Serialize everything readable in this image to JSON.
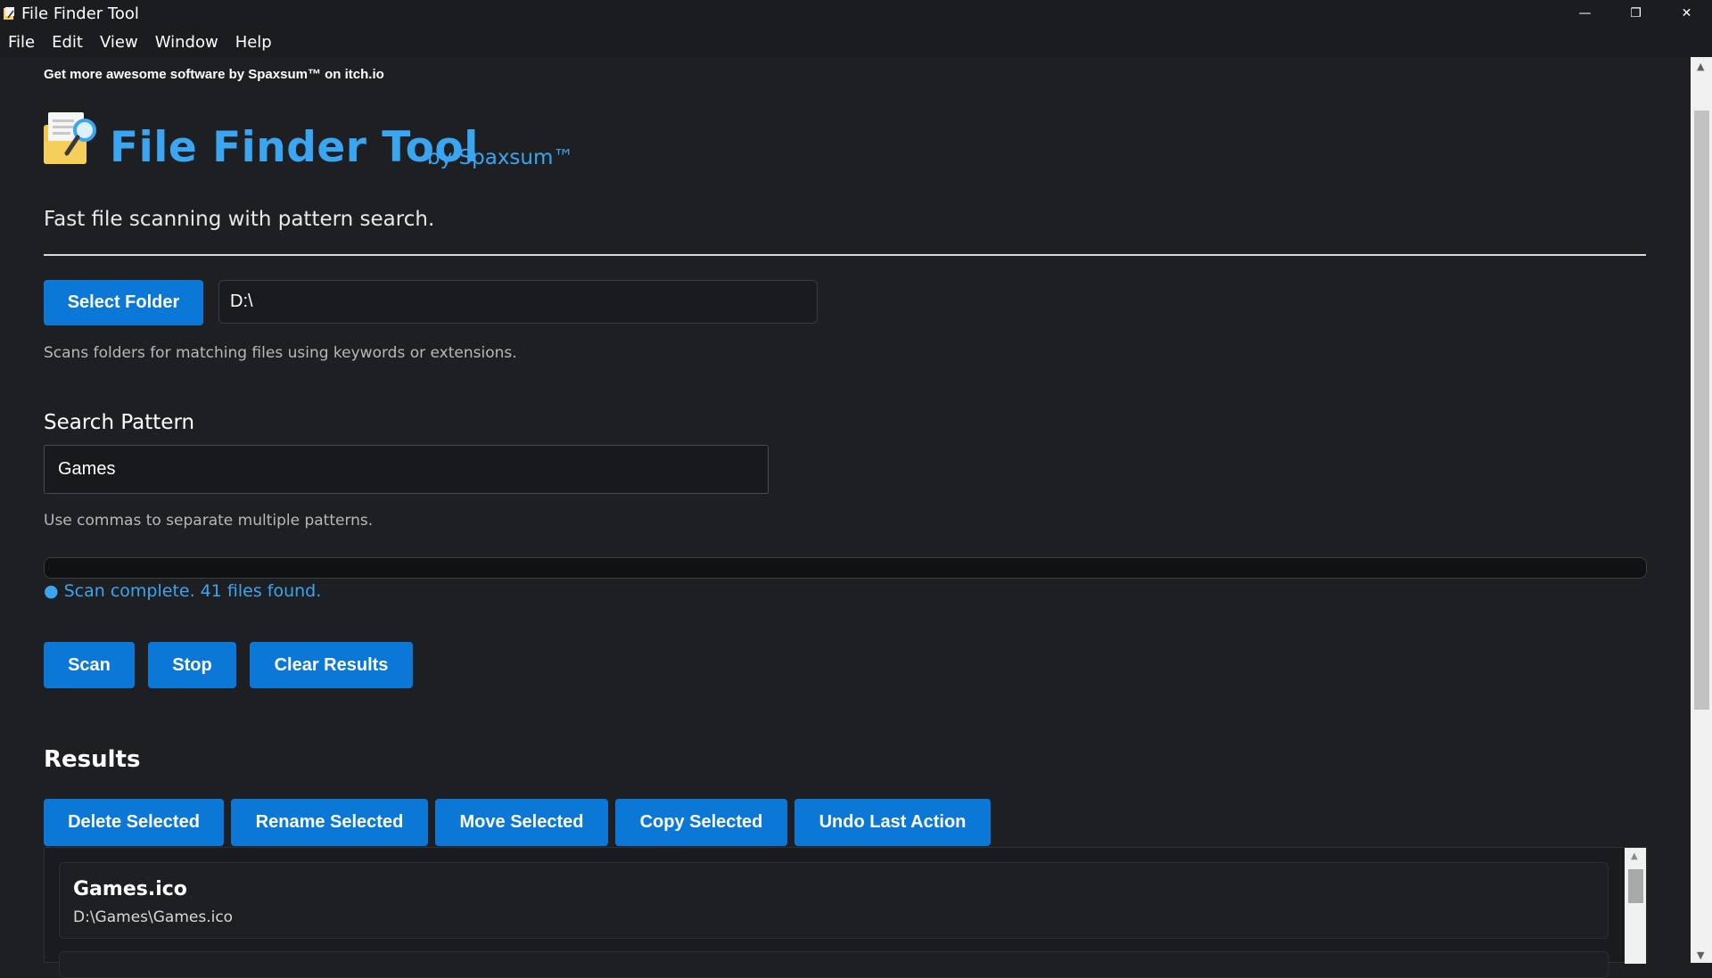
{
  "window": {
    "title": "File Finder Tool",
    "minimize_glyph": "—",
    "restore_glyph": "❐",
    "close_glyph": "✕"
  },
  "menu": [
    "File",
    "Edit",
    "View",
    "Window",
    "Help"
  ],
  "promo": "Get more awesome software by Spaxsum™ on itch.io",
  "header": {
    "title": "File Finder Tool",
    "by": "by Spaxsum™",
    "tagline": "Fast file scanning with pattern search."
  },
  "folder": {
    "button": "Select Folder",
    "path": "D:\\",
    "hint": "Scans folders for matching files using keywords or extensions."
  },
  "search": {
    "label": "Search Pattern",
    "value": "Games",
    "hint": "Use commas to separate multiple patterns."
  },
  "progress": {
    "fraction": 0
  },
  "status": "● Scan complete. 41 files found.",
  "actions": {
    "scan": "Scan",
    "stop": "Stop",
    "clear": "Clear Results"
  },
  "results": {
    "title": "Results",
    "buttons": {
      "delete": "Delete Selected",
      "rename": "Rename Selected",
      "move": "Move Selected",
      "copy": "Copy Selected",
      "undo": "Undo Last Action"
    },
    "items": [
      {
        "name": "Games.ico",
        "path": "D:\\Games\\Games.ico"
      }
    ]
  },
  "colors": {
    "accent": "#3aa5f0",
    "button": "#0b78d8",
    "background": "#1e1f22"
  },
  "icons": {
    "app": "notepad-magnifier-icon",
    "scroll_up": "▲",
    "scroll_down": "▼"
  }
}
